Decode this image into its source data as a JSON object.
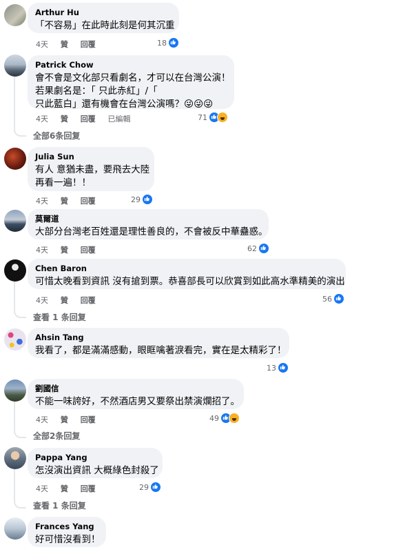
{
  "comments": [
    {
      "author": "Arthur Hu",
      "lines": [
        "「不容易」在此時此刻是何其沉重"
      ],
      "time": "4天",
      "like": "贊",
      "reply": "回覆",
      "edited": "",
      "reactions": "18",
      "reply_link": ""
    },
    {
      "author": "Patrick Chow",
      "lines": [
        "會不會是文化部只看劇名，才可以在台灣公演！",
        "若果劇名是：「 只此赤紅」/「",
        "只此藍白」還有機會在台灣公演嗎？😜😜😜"
      ],
      "time": "4天",
      "like": "贊",
      "reply": "回覆",
      "edited": "已編輯",
      "reactions": "71",
      "reply_link": "全部6条回复"
    },
    {
      "author": "Julia Sun",
      "lines": [
        "有人 意猶未盡，要飛去大陸",
        "再看一遍！！"
      ],
      "time": "4天",
      "like": "贊",
      "reply": "回覆",
      "edited": "",
      "reactions": "29",
      "reply_link": ""
    },
    {
      "author": "莫爾道",
      "lines": [
        "大部分台灣老百姓還是理性善良的，不會被反中華蠱惑。"
      ],
      "time": "4天",
      "like": "贊",
      "reply": "回覆",
      "edited": "",
      "reactions": "62",
      "reply_link": ""
    },
    {
      "author": "Chen Baron",
      "lines": [
        "可惜太晚看到資訊 沒有搶到票。恭喜部長可以欣賞到如此高水準精美的演出"
      ],
      "time": "4天",
      "like": "贊",
      "reply": "回覆",
      "edited": "",
      "reactions": "56",
      "reply_link": "查看 1 条回复"
    },
    {
      "author": "Ahsin Tang",
      "lines": [
        "我看了，都是滿滿感動，眼眶噙著淚看完，實在是太精彩了！"
      ],
      "time": "",
      "like": "",
      "reply": "",
      "edited": "",
      "reactions": "13",
      "reply_link": ""
    },
    {
      "author": "劉國信",
      "lines": [
        "不能一味誇好，不然酒店男又要祭出禁演爛招了。"
      ],
      "time": "4天",
      "like": "贊",
      "reply": "回覆",
      "edited": "",
      "reactions": "49",
      "reply_link": "全部2条回复"
    },
    {
      "author": "Pappa Yang",
      "lines": [
        "怎沒演出資訊 大概綠色封殺了"
      ],
      "time": "4天",
      "like": "贊",
      "reply": "回覆",
      "edited": "",
      "reactions": "29",
      "reply_link": "查看 1 条回复"
    },
    {
      "author": "Frances Yang",
      "lines": [
        "好可惜沒看到！"
      ],
      "time": "",
      "like": "",
      "reply": "",
      "edited": "",
      "reactions": "",
      "reply_link": ""
    }
  ]
}
